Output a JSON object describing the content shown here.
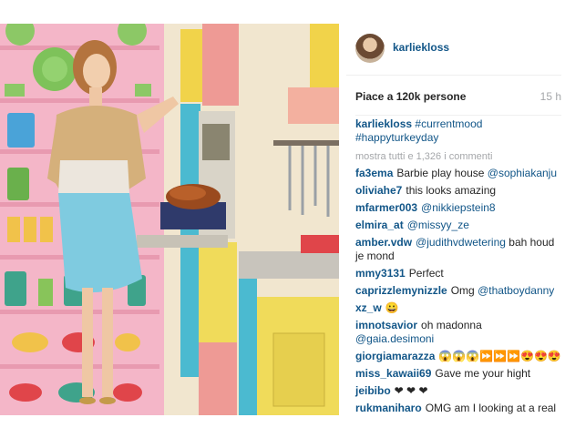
{
  "post": {
    "username": "karliekloss",
    "likes": "Piace a 120k persone",
    "time": "15 h",
    "caption_user": "karliekloss",
    "caption_tags": "#currentmood #happyturkeyday",
    "view_all": "mostra tutti e 1,326 i commenti"
  },
  "comments": [
    {
      "user": "fa3ema",
      "text": "Barbie play house ",
      "mention": "@sophiakanju"
    },
    {
      "user": "oliviahe7",
      "text": "this looks amazing",
      "mention": ""
    },
    {
      "user": "mfarmer003",
      "text": "",
      "mention": "@nikkiepstein8"
    },
    {
      "user": "elmira_at",
      "text": "",
      "mention": "@missyy_ze"
    },
    {
      "user": "amber.vdw",
      "text": " bah houd je mond",
      "mention": "@judithvdwetering"
    },
    {
      "user": "mmy3131",
      "text": "Perfect",
      "mention": ""
    },
    {
      "user": "caprizzlemynizzle",
      "text": "Omg ",
      "mention": "@thatboydanny"
    },
    {
      "user": "xz_w",
      "text": "😀",
      "mention": ""
    },
    {
      "user": "imnotsavior",
      "text": "oh madonna ",
      "mention": "@gaia.desimoni"
    },
    {
      "user": "giorgiamarazza",
      "text": "😱😱😱⏩⏩⏩😍😍😍",
      "mention": ""
    },
    {
      "user": "miss_kawaii69",
      "text": "Gave me your hight",
      "mention": ""
    },
    {
      "user": "jeibibo",
      "text": "❤ ❤ ❤",
      "mention": ""
    },
    {
      "user": "rukmaniharo",
      "text": "OMG am I looking at a real",
      "mention": ""
    }
  ],
  "icons": {
    "avatar": "profile-photo",
    "post_image": "woman-in-retro-kitchen-with-turkey"
  },
  "colors": {
    "link_blue": "#125688",
    "muted_gray": "#a5a7aa"
  }
}
